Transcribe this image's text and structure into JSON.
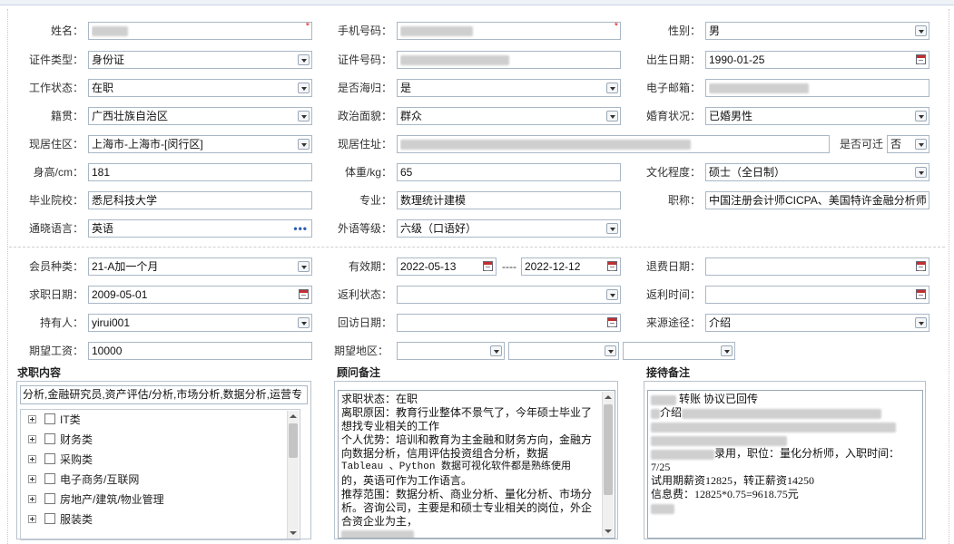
{
  "personal": {
    "name_label": "姓名：",
    "phone_label": "手机号码：",
    "gender_label": "性别：",
    "gender_value": "男",
    "id_type_label": "证件类型：",
    "id_type_value": "身份证",
    "id_no_label": "证件号码：",
    "birth_label": "出生日期：",
    "birth_value": "1990-01-25",
    "work_status_label": "工作状态：",
    "work_status_value": "在职",
    "overseas_label": "是否海归：",
    "overseas_value": "是",
    "email_label": "电子邮箱：",
    "native_label": "籍贯：",
    "native_value": "广西壮族自治区",
    "political_label": "政治面貌：",
    "political_value": "群众",
    "marital_label": "婚育状况：",
    "marital_value": "已婚男性",
    "residence_area_label": "现居住区：",
    "residence_area_value": "上海市-上海市-[闵行区]",
    "address_label": "现居住址：",
    "relocate_label": "是否可迁",
    "relocate_value": "否",
    "height_label": "身高/cm：",
    "height_value": "181",
    "weight_label": "体重/kg：",
    "weight_value": "65",
    "education_label": "文化程度：",
    "education_value": "硕士（全日制）",
    "school_label": "毕业院校：",
    "school_value": "悉尼科技大学",
    "major_label": "专业：",
    "major_value": "数理统计建模",
    "title_label": "职称：",
    "title_value": "中国注册会计师CICPA、美国特许金融分析师",
    "language_label": "通晓语言：",
    "language_value": "英语",
    "foreign_level_label": "外语等级：",
    "foreign_level_value": "六级（口语好）"
  },
  "membership": {
    "member_type_label": "会员种类：",
    "member_type_value": "21-A加一个月",
    "validity_label": "有效期：",
    "validity_start": "2022-05-13",
    "validity_sep": "----",
    "validity_end": "2022-12-12",
    "refund_date_label": "退费日期：",
    "apply_date_label": "求职日期：",
    "apply_date_value": "2009-05-01",
    "rebate_status_label": "返利状态：",
    "rebate_time_label": "返利时间：",
    "holder_label": "持有人：",
    "holder_value": "yirui001",
    "revisit_label": "回访日期：",
    "source_label": "来源途径：",
    "source_value": "介绍",
    "salary_label": "期望工资：",
    "salary_value": "10000",
    "region_label": "期望地区："
  },
  "job_content": {
    "title": "求职内容",
    "summary": "分析,金融研究员,资产评估/分析,市场分析,数据分析,运营专",
    "categories": [
      "IT类",
      "财务类",
      "采购类",
      "电子商务/互联网",
      "房地产/建筑/物业管理",
      "服装类"
    ]
  },
  "advisor_notes": {
    "title": "顾问备注",
    "lines": [
      "求职状态：在职",
      "离职原因：教育行业整体不景气了，今年硕士毕业了",
      "想找专业相关的工作",
      "个人优势：培训和教育为主金融和财务方向，金融方",
      "向数据分析，信用评估投资组合分析，数据",
      "Tableau 、Python 数据可视化软件都是熟练使用",
      "的，英语可作为工作语言。",
      "推荐范围：数据分析、商业分析、量化分析、市场分",
      "析。咨询公司，主要是和硕士专业相关的岗位，外企",
      "合资企业为主，"
    ]
  },
  "reception_notes": {
    "title": "接待备注",
    "line1": "转账  协议已回传",
    "line2": "介绍",
    "line3": "录用，职位：量化分析师，入职时间：",
    "line4": "7/25",
    "line5": "试用期薪资12825，转正薪资14250",
    "line6": "信息费：12825*0.75=9618.75元"
  }
}
